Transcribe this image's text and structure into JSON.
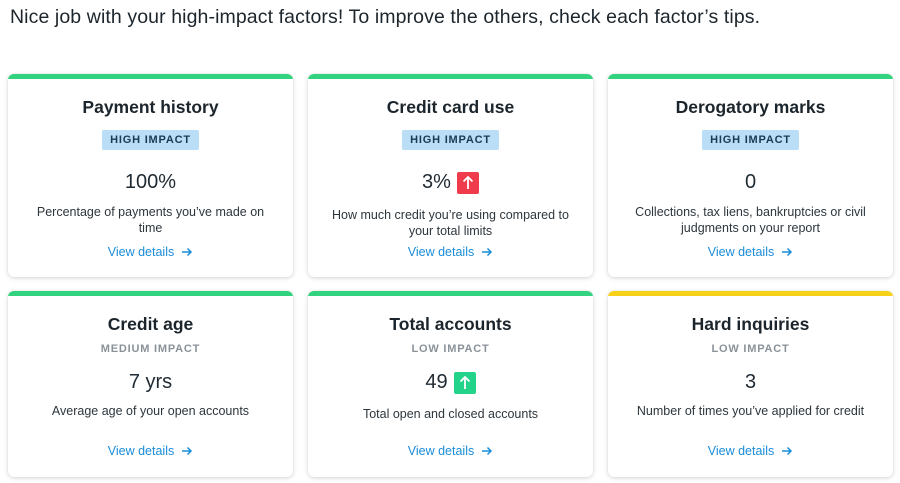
{
  "headline": "Nice job with your high-impact factors! To improve the others, check each factor’s tips.",
  "colors": {
    "green_bar": "#33d27f",
    "yellow_bar": "#f7d117",
    "link": "#1a8dd8",
    "badge_bg": "#b9def5"
  },
  "cards": [
    {
      "title": "Payment history",
      "impact": "HIGH IMPACT",
      "value": "100%",
      "trend": "",
      "description": "Percentage of payments you’ve made on time",
      "link": "View details"
    },
    {
      "title": "Credit card use",
      "impact": "HIGH IMPACT",
      "value": "3%",
      "trend": "up-red-arrow-icon",
      "description": "How much credit you’re using compared to your total limits",
      "link": "View details"
    },
    {
      "title": "Derogatory marks",
      "impact": "HIGH IMPACT",
      "value": "0",
      "trend": "",
      "description": "Collections, tax liens, bankruptcies or civil judgments on your report",
      "link": "View details"
    },
    {
      "title": "Credit age",
      "impact": "MEDIUM IMPACT",
      "value": "7 yrs",
      "trend": "",
      "description": "Average age of your open accounts",
      "link": "View details"
    },
    {
      "title": "Total accounts",
      "impact": "LOW IMPACT",
      "value": "49",
      "trend": "up-green-arrow-icon",
      "description": "Total open and closed accounts",
      "link": "View details"
    },
    {
      "title": "Hard inquiries",
      "impact": "LOW IMPACT",
      "value": "3",
      "trend": "",
      "description": "Number of times you’ve applied for credit",
      "link": "View details"
    }
  ]
}
